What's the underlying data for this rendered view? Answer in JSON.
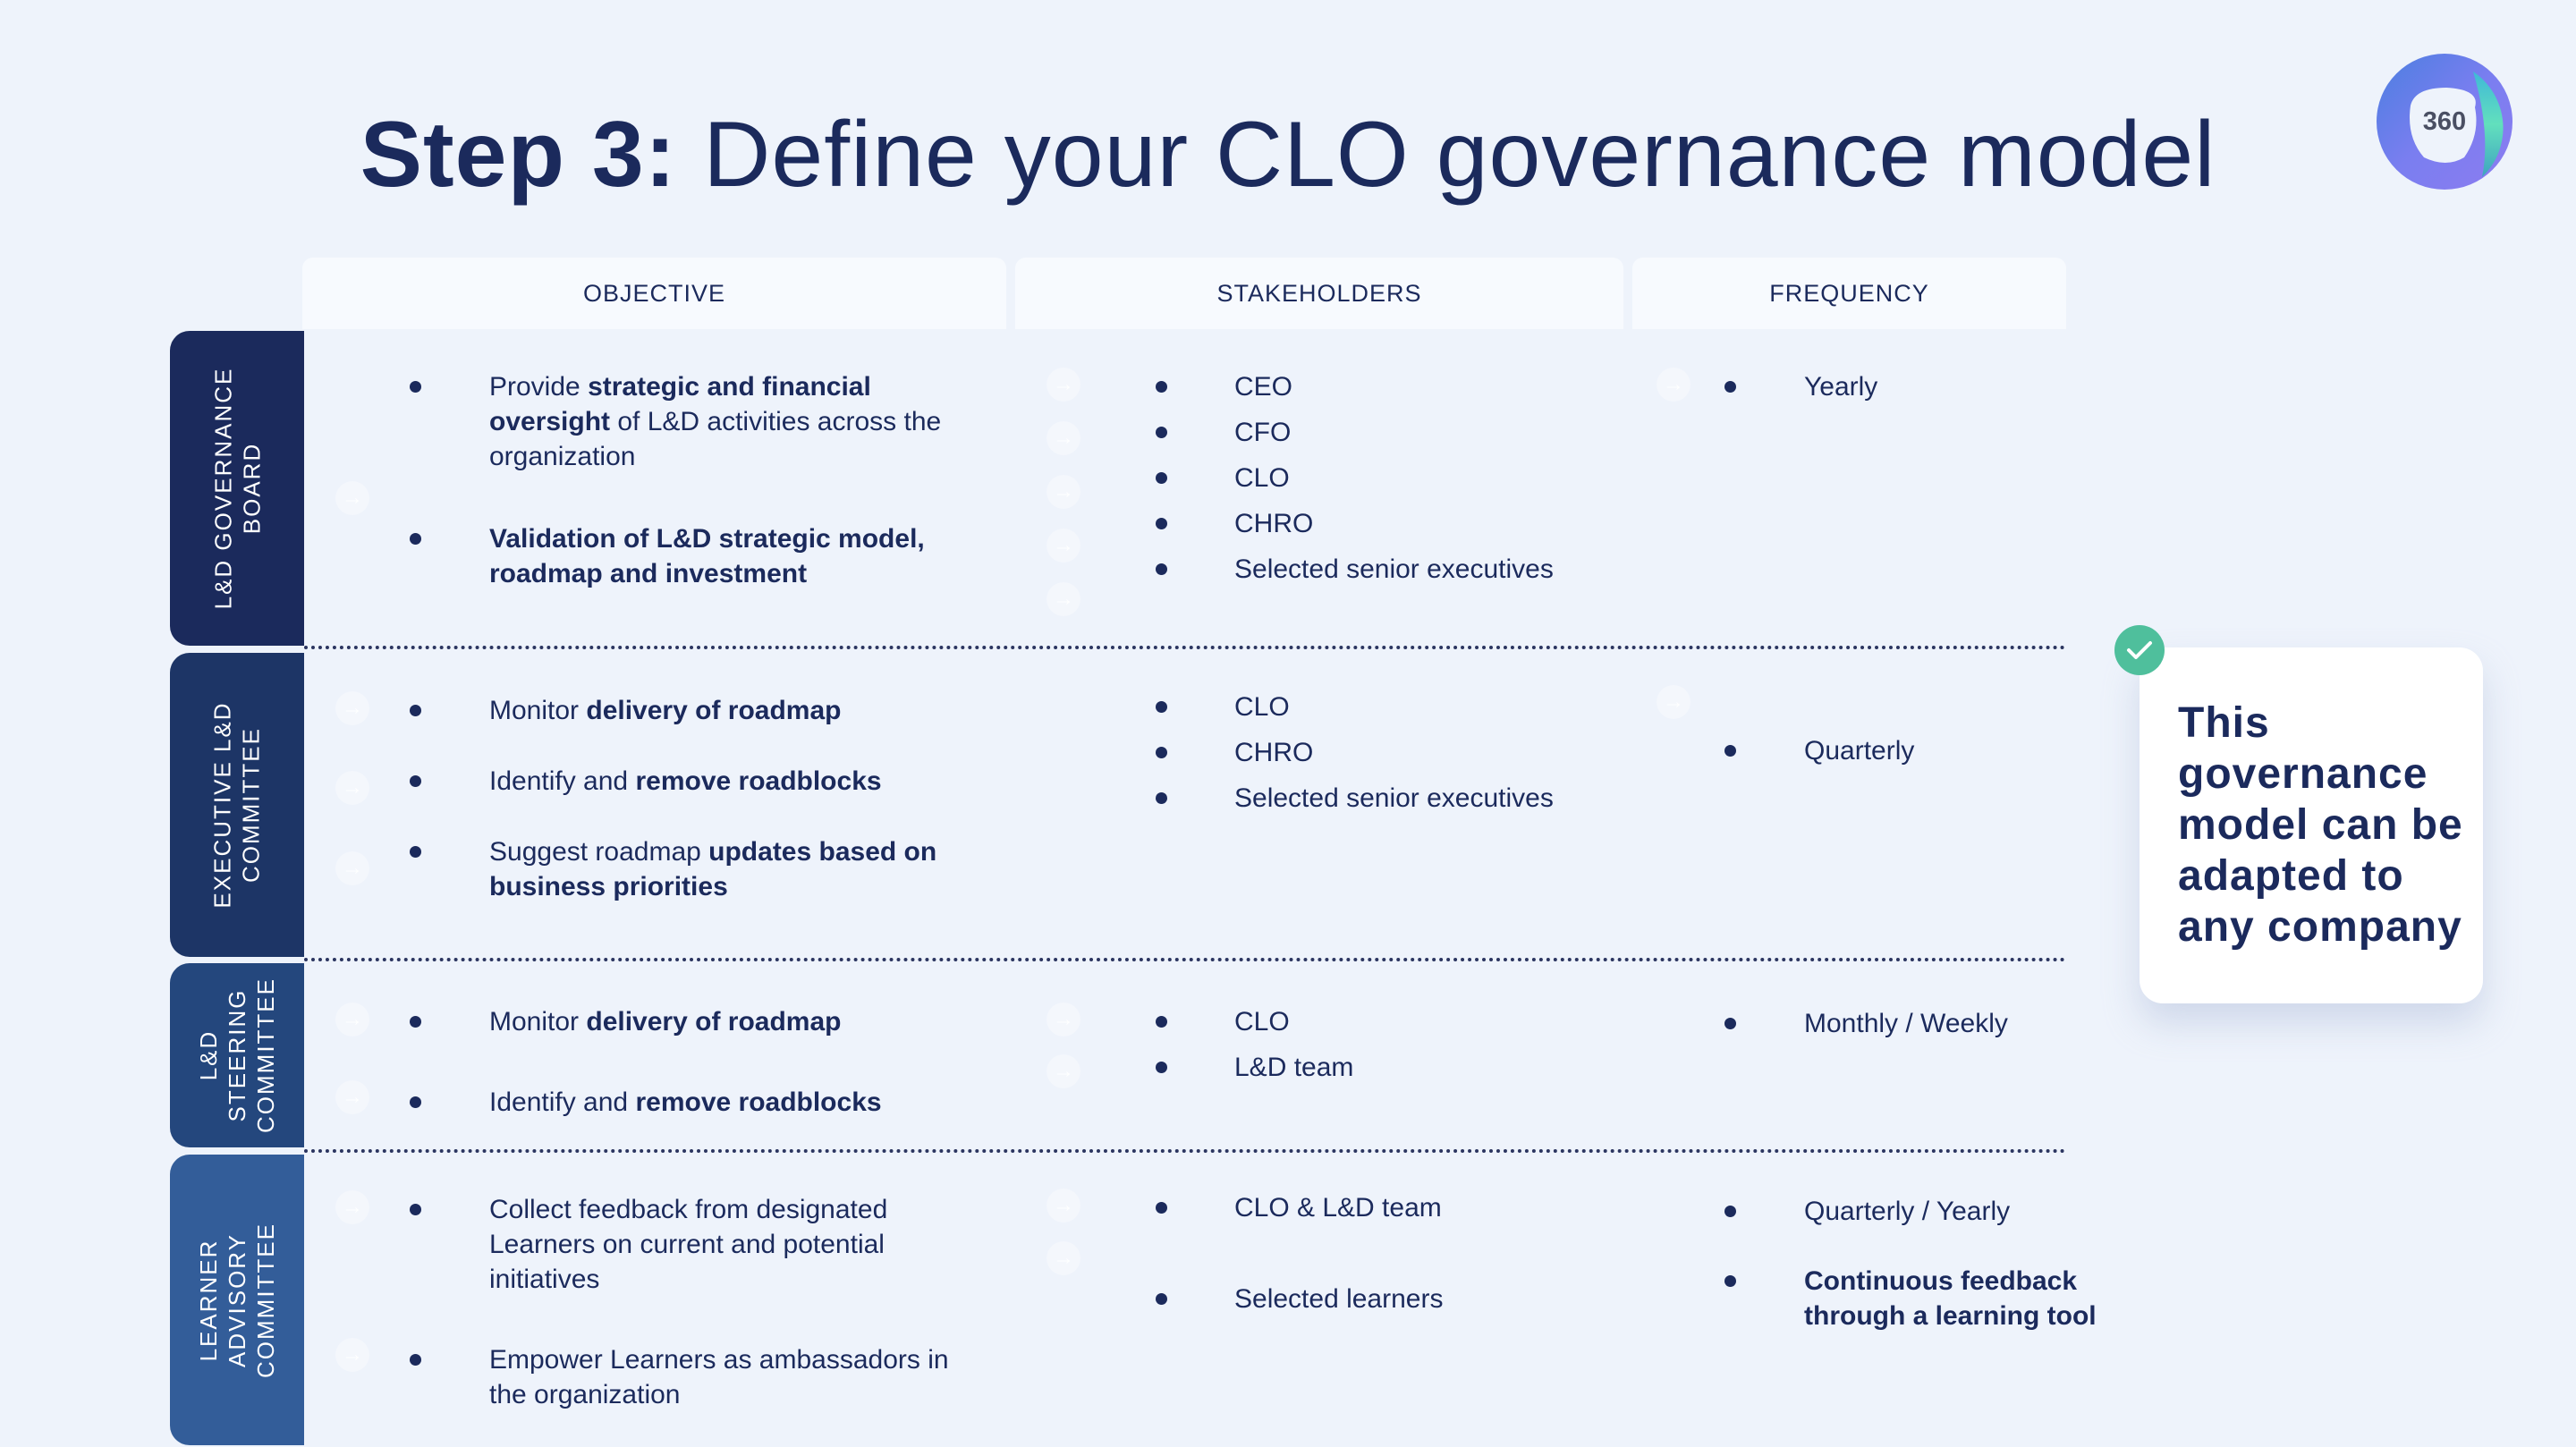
{
  "title": {
    "bold": "Step 3:",
    "rest": "Define your CLO governance model"
  },
  "logo": {
    "text": "360",
    "icon": "brand-logo-ring"
  },
  "columns": [
    {
      "label": "OBJECTIVE"
    },
    {
      "label": "STAKEHOLDERS"
    },
    {
      "label": "FREQUENCY"
    }
  ],
  "rows": [
    {
      "label_lines": [
        "L&D GOVERNANCE",
        "BOARD"
      ],
      "color": "#1b2a5c",
      "objectives": [
        {
          "parts": [
            {
              "t": "Provide ",
              "b": false
            },
            {
              "t": "strategic and financial oversight",
              "b": true
            },
            {
              "t": " of L&D activities across the organization",
              "b": false
            }
          ]
        },
        {
          "parts": [
            {
              "t": "Validation of L&D strategic model, roadmap and investment",
              "b": true
            }
          ]
        }
      ],
      "stakeholders": [
        "CEO",
        "CFO",
        "CLO",
        "CHRO",
        "Selected senior executives"
      ],
      "frequency": [
        {
          "parts": [
            {
              "t": "Yearly",
              "b": false
            }
          ]
        }
      ]
    },
    {
      "label_lines": [
        "EXECUTIVE L&D",
        "COMMITTEE"
      ],
      "color": "#1d3566",
      "objectives": [
        {
          "parts": [
            {
              "t": "Monitor ",
              "b": false
            },
            {
              "t": "delivery of roadmap",
              "b": true
            }
          ]
        },
        {
          "parts": [
            {
              "t": "Identify and ",
              "b": false
            },
            {
              "t": "remove roadblocks",
              "b": true
            }
          ]
        },
        {
          "parts": [
            {
              "t": "Suggest roadmap ",
              "b": false
            },
            {
              "t": "updates based on business priorities",
              "b": true
            }
          ]
        }
      ],
      "stakeholders": [
        "CLO",
        "CHRO",
        "Selected senior executives"
      ],
      "frequency": [
        {
          "parts": [
            {
              "t": "Quarterly",
              "b": false
            }
          ]
        }
      ]
    },
    {
      "label_lines": [
        "L&D",
        "STEERING",
        "COMMITTEE"
      ],
      "color": "#24477d",
      "objectives": [
        {
          "parts": [
            {
              "t": "Monitor ",
              "b": false
            },
            {
              "t": "delivery of roadmap",
              "b": true
            }
          ]
        },
        {
          "parts": [
            {
              "t": "Identify and ",
              "b": false
            },
            {
              "t": "remove roadblocks",
              "b": true
            }
          ]
        }
      ],
      "stakeholders": [
        "CLO",
        "L&D team"
      ],
      "frequency": [
        {
          "parts": [
            {
              "t": "Monthly / Weekly",
              "b": false
            }
          ]
        }
      ]
    },
    {
      "label_lines": [
        "LEARNER",
        "ADVISORY",
        "COMMITTEE"
      ],
      "color": "#335d99",
      "objectives": [
        {
          "parts": [
            {
              "t": "Collect feedback from designated Learners on current and potential initiatives",
              "b": false
            }
          ]
        },
        {
          "parts": [
            {
              "t": "Empower Learners as ambassadors in the organization",
              "b": false
            }
          ]
        }
      ],
      "stakeholders": [
        "CLO & L&D team",
        "Selected learners"
      ],
      "frequency": [
        {
          "parts": [
            {
              "t": "Quarterly / Yearly",
              "b": false
            }
          ]
        },
        {
          "parts": [
            {
              "t": "Continuous feedback through a learning tool",
              "b": true
            }
          ]
        }
      ]
    }
  ],
  "callout": {
    "text": "This governance model can be adapted to any company",
    "icon": "check-icon",
    "accent": "#4fbf9c"
  }
}
